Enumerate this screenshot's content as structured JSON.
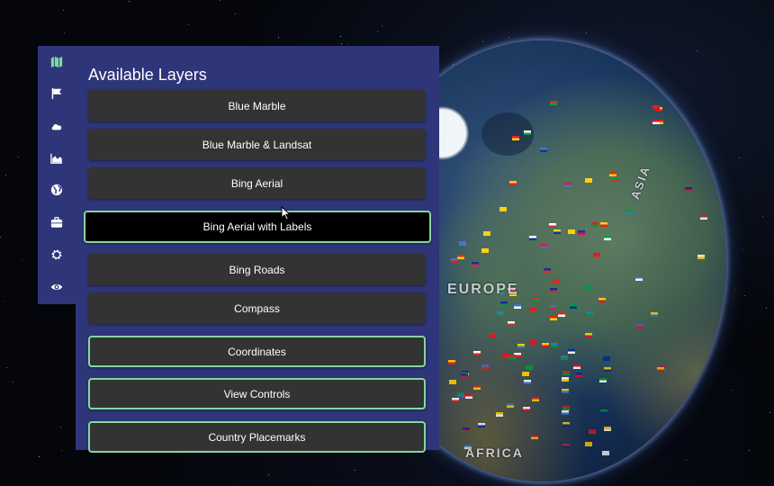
{
  "sidebar": {
    "items": [
      {
        "icon": "map-icon",
        "active": true
      },
      {
        "icon": "flag-icon"
      },
      {
        "icon": "cloud-icon"
      },
      {
        "icon": "area-chart-icon"
      },
      {
        "icon": "globe-icon"
      },
      {
        "icon": "briefcase-icon"
      },
      {
        "icon": "settings-icon"
      },
      {
        "icon": "eye-icon"
      }
    ]
  },
  "panel": {
    "title": "Available Layers",
    "layers": [
      {
        "label": "Blue Marble",
        "enabled": false
      },
      {
        "label": "Blue Marble & Landsat",
        "enabled": false
      },
      {
        "label": "Bing Aerial",
        "enabled": false
      },
      {
        "label": "Bing Aerial with Labels",
        "enabled": false,
        "hovered": true
      },
      {
        "label": "Bing Roads",
        "enabled": false
      },
      {
        "label": "Compass",
        "enabled": false
      },
      {
        "label": "Coordinates",
        "enabled": true
      },
      {
        "label": "View Controls",
        "enabled": true
      },
      {
        "label": "Country Placemarks",
        "enabled": true
      }
    ]
  },
  "globe": {
    "labels": [
      "ASIA",
      "EUROPE",
      "AFRICA"
    ]
  },
  "colors": {
    "panel_bg": "#2e3578",
    "button_bg": "#333333",
    "active_border": "#86d79e",
    "active_icon": "#7fd8a0"
  }
}
